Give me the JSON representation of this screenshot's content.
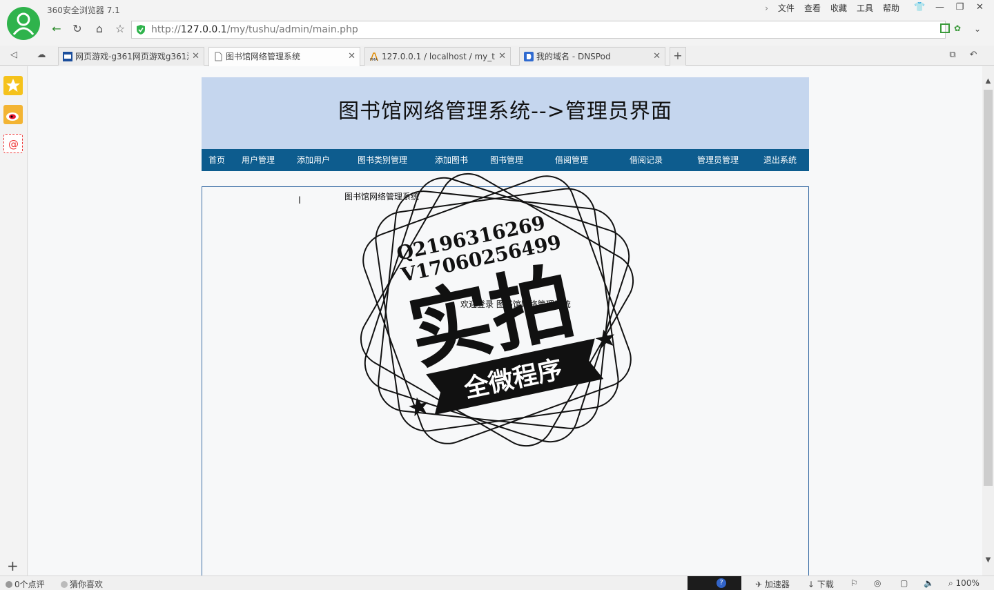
{
  "browser": {
    "app_title": "360安全浏览器 7.1",
    "menu": [
      "文件",
      "查看",
      "收藏",
      "工具",
      "帮助"
    ],
    "address": {
      "prefix": "http://",
      "host": "127.0.0.1",
      "path": "/my/tushu/admin/main.php"
    },
    "tabs": [
      {
        "label": "网页游戏-g361网页游戏g361游",
        "icon": "g361-favicon"
      },
      {
        "label": "图书馆网络管理系统",
        "icon": "page-icon",
        "active": true
      },
      {
        "label": "127.0.0.1 / localhost / my_tushu",
        "icon": "phpmyadmin-icon"
      },
      {
        "label": "我的域名 - DNSPod",
        "icon": "dnspod-icon"
      }
    ]
  },
  "page": {
    "banner_title": "图书馆网络管理系统-->管理员界面",
    "nav": [
      "首页",
      "用户管理",
      "添加用户",
      "图书类别管理",
      "添加图书",
      "图书管理",
      "借阅管理",
      "借阅记录",
      "管理员管理",
      "退出系统"
    ],
    "frame_title": "图书馆网络管理系统",
    "welcome": "欢迎登录 图书馆网络管理系统"
  },
  "watermark": {
    "qq": "Q2196316269",
    "wechat": "V17060256499",
    "big": "实拍",
    "ribbon": "全微程序"
  },
  "statusbar": {
    "reviews": "0个点评",
    "guess": "猜你喜欢",
    "accelerator": "加速器",
    "download": "下载",
    "zoom": "100%"
  },
  "colors": {
    "banner_bg": "#c5d6ee",
    "nav_bg": "#0d5c8e",
    "logo_green": "#2fb34c"
  }
}
